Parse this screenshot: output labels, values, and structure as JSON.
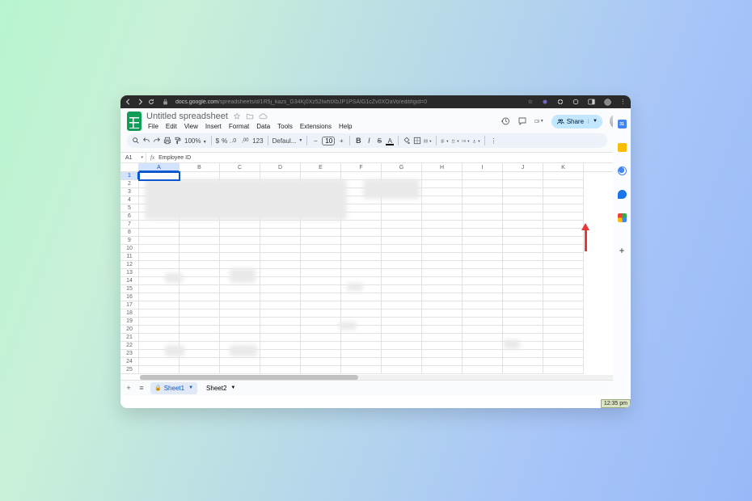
{
  "browser": {
    "url_host": "docs.google.com",
    "url_path": "/spreadsheets/d/1R5j_kazs_G34Kj0Xz52IwhtXbJP1PSAIG1cZv0XOaVo/edit#gid=0"
  },
  "doc": {
    "title": "Untitled spreadsheet"
  },
  "menus": [
    "File",
    "Edit",
    "View",
    "Insert",
    "Format",
    "Data",
    "Tools",
    "Extensions",
    "Help"
  ],
  "header": {
    "share": "Share"
  },
  "toolbar": {
    "zoom": "100%",
    "currency": "$",
    "percent": "%",
    "dec_dec": ".0",
    "dec_inc": ".00",
    "format123": "123",
    "font": "Defaul...",
    "font_size": "10",
    "bold": "B",
    "italic": "I",
    "strike": "S",
    "underline_A": "A"
  },
  "namebox": "A1",
  "fx_value": "Employee ID",
  "columns": [
    "A",
    "B",
    "C",
    "D",
    "E",
    "F",
    "G",
    "H",
    "I",
    "J",
    "K"
  ],
  "selected_col": "A",
  "row_count": 25,
  "selected_row": 1,
  "sheet_tabs": {
    "active": "Sheet1",
    "others": [
      "Sheet2"
    ]
  },
  "clock": "12:35 pm"
}
